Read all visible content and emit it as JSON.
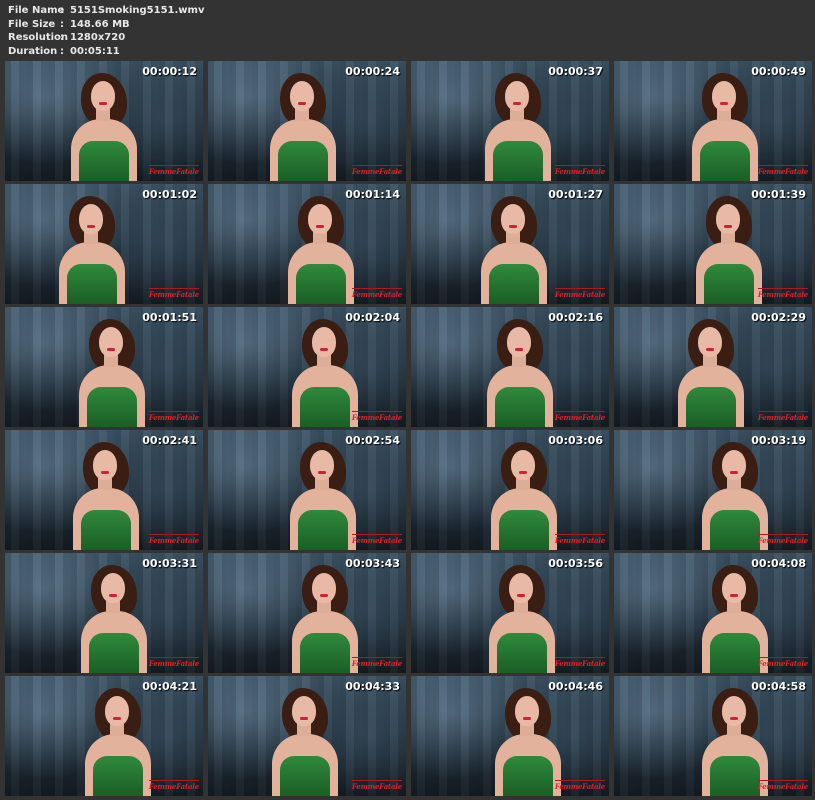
{
  "info": {
    "name_label": "File Name",
    "name_value": "5151Smoking5151.wmv",
    "size_label": "File Size",
    "size_value": "148.66 MB",
    "res_label": "Resolution",
    "res_value": "1280x720",
    "dur_label": "Duration",
    "dur_value": "00:05:11",
    "separator": ":"
  },
  "logo_text": "FemmeFatale",
  "thumbnails": [
    {
      "time": "00:00:12"
    },
    {
      "time": "00:00:24"
    },
    {
      "time": "00:00:37"
    },
    {
      "time": "00:00:49"
    },
    {
      "time": "00:01:02"
    },
    {
      "time": "00:01:14"
    },
    {
      "time": "00:01:27"
    },
    {
      "time": "00:01:39"
    },
    {
      "time": "00:01:51"
    },
    {
      "time": "00:02:04"
    },
    {
      "time": "00:02:16"
    },
    {
      "time": "00:02:29"
    },
    {
      "time": "00:02:41"
    },
    {
      "time": "00:02:54"
    },
    {
      "time": "00:03:06"
    },
    {
      "time": "00:03:19"
    },
    {
      "time": "00:03:31"
    },
    {
      "time": "00:03:43"
    },
    {
      "time": "00:03:56"
    },
    {
      "time": "00:04:08"
    },
    {
      "time": "00:04:21"
    },
    {
      "time": "00:04:33"
    },
    {
      "time": "00:04:46"
    },
    {
      "time": "00:04:58"
    }
  ]
}
